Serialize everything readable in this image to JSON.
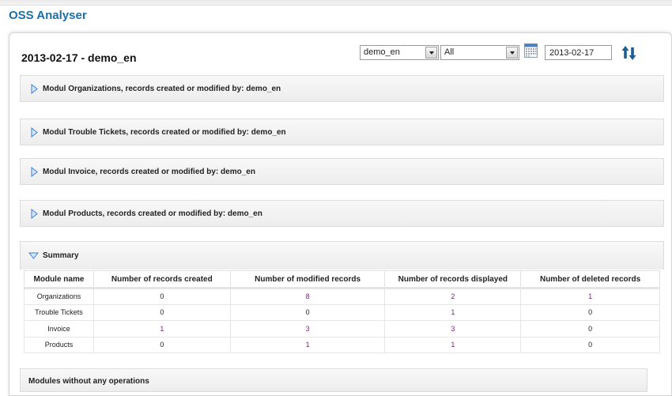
{
  "app": {
    "title": "OSS Analyser"
  },
  "header": {
    "title": "2013-02-17 - demo_en",
    "user_select": "demo_en",
    "filter_select": "All",
    "date_value": "2013-02-17"
  },
  "modules": [
    {
      "label": "Modul Organizations, records created or modified by: demo_en"
    },
    {
      "label": "Modul Trouble Tickets, records created or modified by: demo_en"
    },
    {
      "label": "Modul Invoice, records created or modified by: demo_en"
    },
    {
      "label": "Modul Products, records created or modified by: demo_en"
    }
  ],
  "summary": {
    "label": "Summary",
    "columns": [
      "Module name",
      "Number of records created",
      "Number of modified records",
      "Number of records displayed",
      "Number of deleted records"
    ],
    "rows": [
      [
        "Organizations",
        "0",
        "8",
        "2",
        "1"
      ],
      [
        "Trouble Tickets",
        "0",
        "0",
        "1",
        "0"
      ],
      [
        "Invoice",
        "1",
        "3",
        "3",
        "0"
      ],
      [
        "Products",
        "0",
        "1",
        "1",
        "0"
      ]
    ]
  },
  "no_operations": {
    "label": "Modules without any operations"
  },
  "colors": {
    "title_blue": "#1a6fa8",
    "expander_blue": "#3f7fd6"
  },
  "icons": [
    "calendar-icon",
    "sort-arrows-icon",
    "expand-right-icon",
    "collapse-down-icon"
  ]
}
